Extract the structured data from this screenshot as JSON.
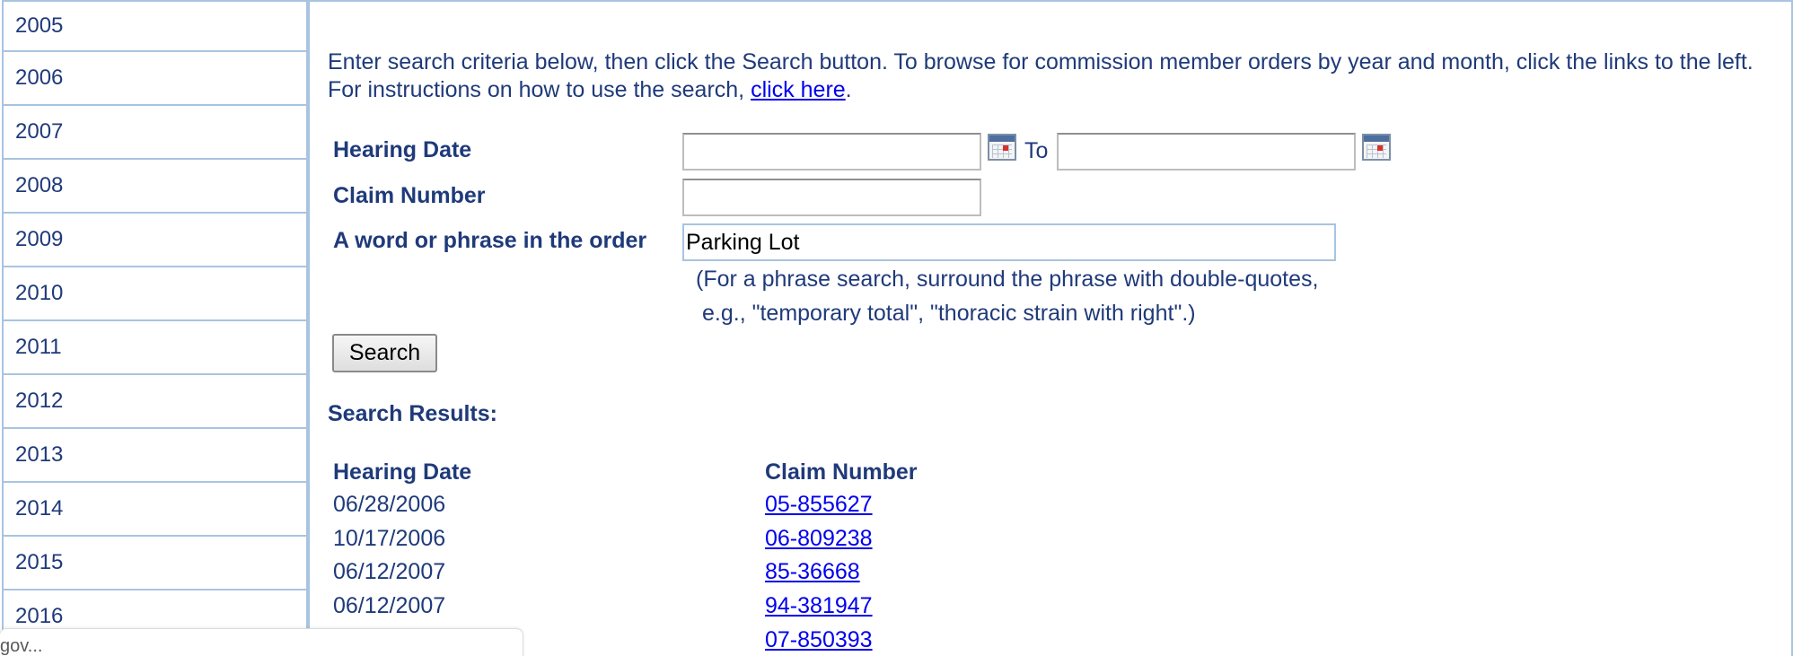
{
  "sidebar": {
    "years": [
      "2005",
      "2006",
      "2007",
      "2008",
      "2009",
      "2010",
      "2011",
      "2012",
      "2013",
      "2014",
      "2015",
      "2016"
    ]
  },
  "intro": {
    "text": "Enter search criteria below, then click the Search button.  To browse for commission member orders by year and month, click the links to the left.  For instructions on how to use the search, ",
    "link": "click here",
    "end": "."
  },
  "form": {
    "hearing_date_label": "Hearing Date",
    "hearing_from_value": "",
    "to_label": "To",
    "hearing_to_value": "",
    "claim_number_label": "Claim Number",
    "claim_number_value": "",
    "phrase_label": "A word or phrase in the order",
    "phrase_value": "Parking Lot",
    "hint_line1": "(For a phrase search, surround the phrase with double-quotes,",
    "hint_line2": "e.g., \"temporary total\", \"thoracic strain with right\".)",
    "search_button": "Search"
  },
  "results": {
    "title": "Search Results:",
    "columns": [
      "Hearing Date",
      "Claim Number"
    ],
    "rows": [
      {
        "date": "06/28/2006",
        "claim": "05-855627"
      },
      {
        "date": "10/17/2006",
        "claim": "06-809238"
      },
      {
        "date": "06/12/2007",
        "claim": "85-36668"
      },
      {
        "date": "06/12/2007",
        "claim": "94-381947"
      },
      {
        "date": "",
        "claim": "07-850393"
      }
    ]
  },
  "status_bar": {
    "text": "gov..."
  },
  "colors": {
    "text": "#1f3a7a",
    "border": "#a8c4e0",
    "link": "#0000ee"
  },
  "icons": [
    "calendar-icon"
  ]
}
